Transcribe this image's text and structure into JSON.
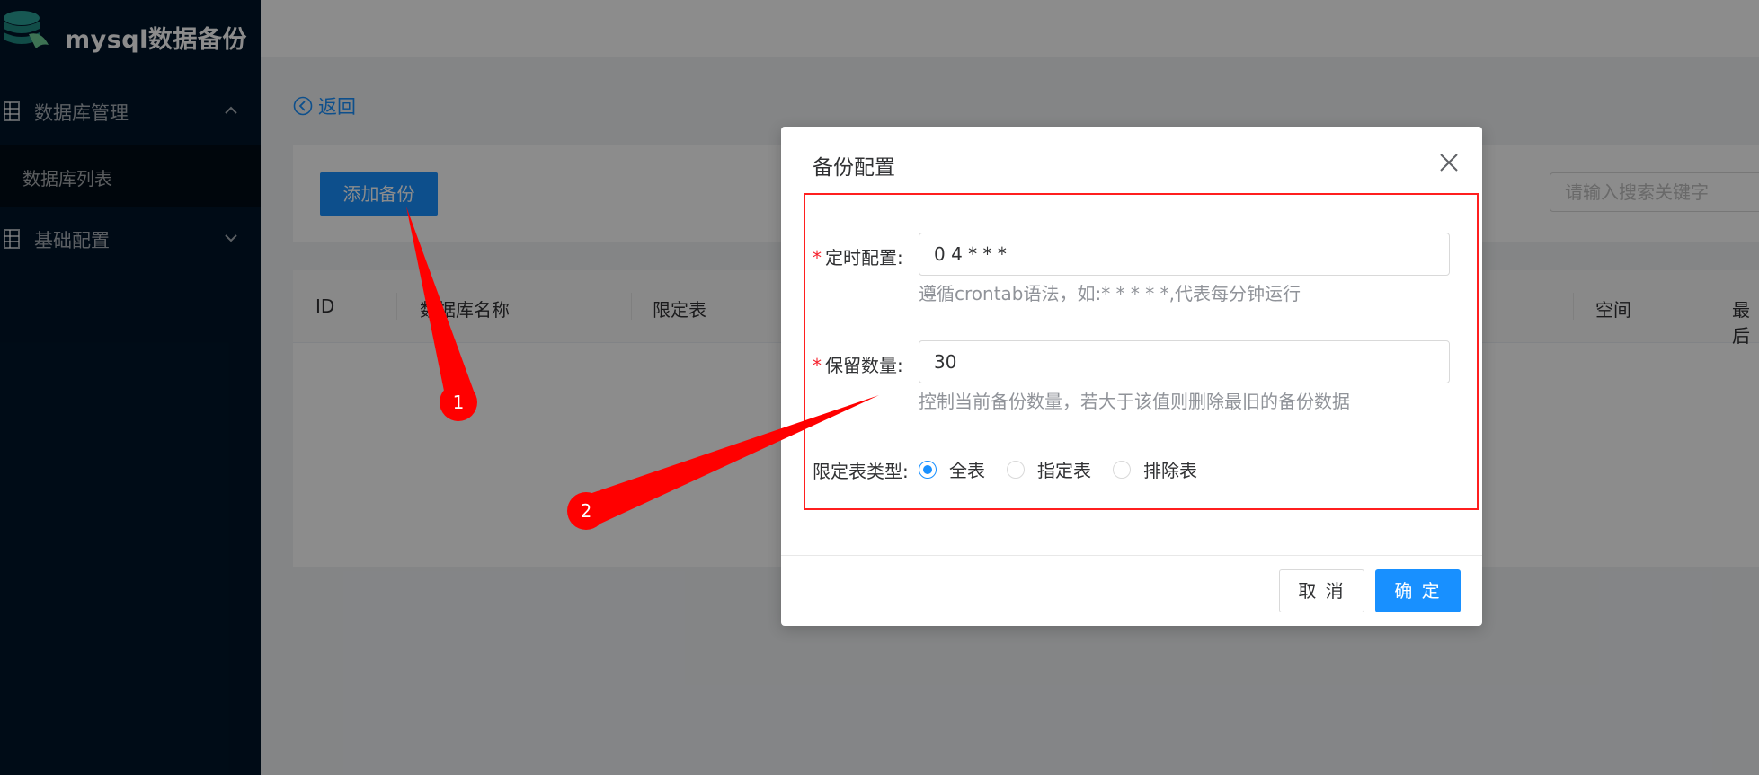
{
  "app": {
    "title": "mysql数据备份"
  },
  "sidebar": {
    "items": [
      {
        "label": "数据库管理",
        "icon": "table-icon",
        "expanded": true,
        "children": [
          {
            "label": "数据库列表",
            "active": true
          }
        ]
      },
      {
        "label": "基础配置",
        "icon": "table-icon",
        "expanded": false
      }
    ]
  },
  "main": {
    "back_label": "返回",
    "add_button": "添加备份",
    "search_placeholder": "请输入搜索关键字",
    "table": {
      "columns": [
        "ID",
        "数据库名称",
        "限定表",
        "空间",
        "最后"
      ]
    }
  },
  "modal": {
    "title": "备份配置",
    "fields": {
      "schedule": {
        "label": "定时配置:",
        "value": "0 4 * * *",
        "help": "遵循crontab语法，如:* * * * *,代表每分钟运行"
      },
      "retention": {
        "label": "保留数量:",
        "value": "30",
        "help": "控制当前备份数量，若大于该值则删除最旧的备份数据"
      },
      "table_type": {
        "label": "限定表类型:",
        "options": [
          "全表",
          "指定表",
          "排除表"
        ],
        "selected": "全表"
      }
    },
    "cancel_label": "取 消",
    "ok_label": "确 定"
  },
  "annotations": {
    "badge_1": "1",
    "badge_2": "2",
    "color": "#ff0000"
  },
  "colors": {
    "primary": "#1890ff",
    "sidebar_bg": "#001529",
    "required": "#f5222d"
  }
}
